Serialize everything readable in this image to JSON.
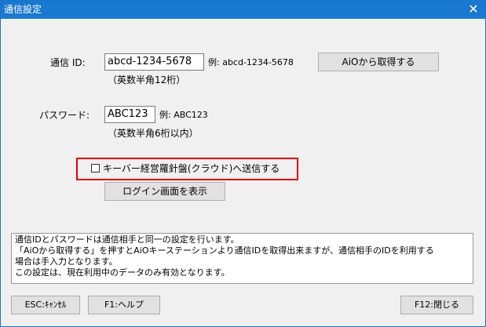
{
  "window": {
    "title": "通信設定",
    "close_glyph": "✕"
  },
  "comm_id": {
    "label": "通信 ID:",
    "value": "abcd-1234-5678",
    "example": "例: abcd-1234-5678",
    "hint": "（英数半角12桁）"
  },
  "fetch_button": {
    "label": "AiOから取得する"
  },
  "password": {
    "label": "パスワード:",
    "value": "ABC123",
    "example": "例: ABC123",
    "hint": "（英数半角6桁以内）"
  },
  "cloud_checkbox": {
    "label": "キーバー経営羅針盤(クラウド)へ送信する",
    "checked": false
  },
  "login_button": {
    "label": "ログイン画面を表示"
  },
  "info": {
    "lines": [
      "通信IDとパスワードは通信相手と同一の設定を行います。",
      "「AiOから取得する」を押すとAiOキーステーションより通信IDを取得出来ますが、通信相手のIDを利用する",
      "場合は手入力となります。",
      "この設定は、現在利用中のデータのみ有効となります。"
    ]
  },
  "footer": {
    "cancel_label": "ESC:ｷｬﾝｾﾙ",
    "help_label": "F1:ヘルプ",
    "close_label": "F12:閉じる"
  },
  "colors": {
    "titlebar": "#1979d0",
    "highlight": "#e00000",
    "background": "#f0f0f0"
  }
}
